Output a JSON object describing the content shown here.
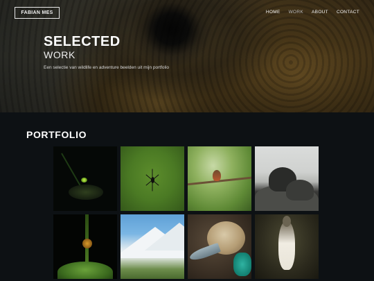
{
  "header": {
    "logo": "FABIAN MES",
    "nav": [
      {
        "label": "HOME",
        "active": false
      },
      {
        "label": "WORK",
        "active": true
      },
      {
        "label": "ABOUT",
        "active": false
      },
      {
        "label": "CONTACT",
        "active": false
      }
    ]
  },
  "hero": {
    "title_line1": "SELECTED",
    "title_line2": "WORK",
    "subtitle": "Een selectie van wildlife en adventure beelden uit mijn portfolio"
  },
  "portfolio": {
    "title": "PORTFOLIO",
    "images": [
      {
        "subject": "firefly"
      },
      {
        "subject": "spider"
      },
      {
        "subject": "hummingbird"
      },
      {
        "subject": "marine iguanas"
      },
      {
        "subject": "frog"
      },
      {
        "subject": "snowy mountains"
      },
      {
        "subject": "blue-footed booby head"
      },
      {
        "subject": "blue-footed booby"
      }
    ]
  },
  "colors": {
    "background": "#0d1114",
    "text": "#ffffff",
    "nav_active": "#bdbdbd"
  }
}
